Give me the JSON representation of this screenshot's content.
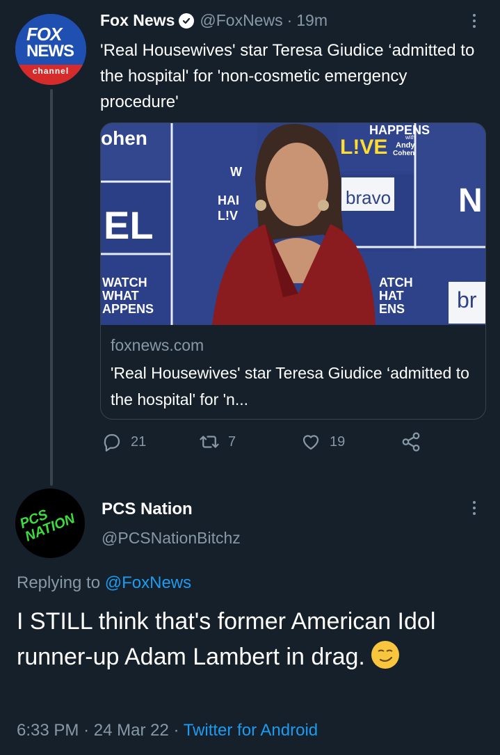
{
  "tweet": {
    "display_name": "Fox News",
    "handle": "@FoxNews",
    "separator": "·",
    "time_ago": "19m",
    "avatar": {
      "line1": "FOX",
      "line2": "NEWS",
      "line3": "channel"
    },
    "text": "'Real Housewives' star Teresa Giudice ‘admitted to the hospital' for 'non-cosmetic emergency procedure'",
    "card": {
      "domain": "foxnews.com",
      "title": "'Real Housewives' star Teresa Giudice ‘admitted to the hospital' for 'n...",
      "image_texts": {
        "cohen": "ohen",
        "happens": "HAPPENS",
        "live": "L!VE",
        "with": "with",
        "andy": "Andy",
        "cohen_small": "Cohen",
        "bravo": "bravo",
        "el": "EL",
        "watch_left": "WATCH\nWHAT\nAPPENS",
        "watch_right": "ATCH\nHAT\nENS",
        "hal": "HAI\nL!V",
        "w": "W",
        "br": "br",
        "n": "N"
      }
    },
    "counts": {
      "replies": "21",
      "retweets": "7",
      "likes": "19"
    }
  },
  "reply": {
    "display_name": "PCS Nation",
    "handle": "@PCSNationBitchz",
    "avatar_text": "PCS NATION",
    "replying_prefix": "Replying to",
    "replying_to": "@FoxNews",
    "text": "I STILL think that's former American Idol runner-up Adam Lambert in drag.",
    "time": "6:33 PM",
    "separator1": "·",
    "date": "24 Mar 22",
    "separator2": "·",
    "source": "Twitter for Android"
  },
  "colors": {
    "background": "#15202b",
    "muted": "#8899a6",
    "link": "#1d9bf0",
    "border": "#38444d"
  },
  "icons": [
    "verified-badge-icon",
    "more-options-icon",
    "reply-icon",
    "retweet-icon",
    "like-icon",
    "share-icon",
    "smirk-emoji-icon"
  ]
}
